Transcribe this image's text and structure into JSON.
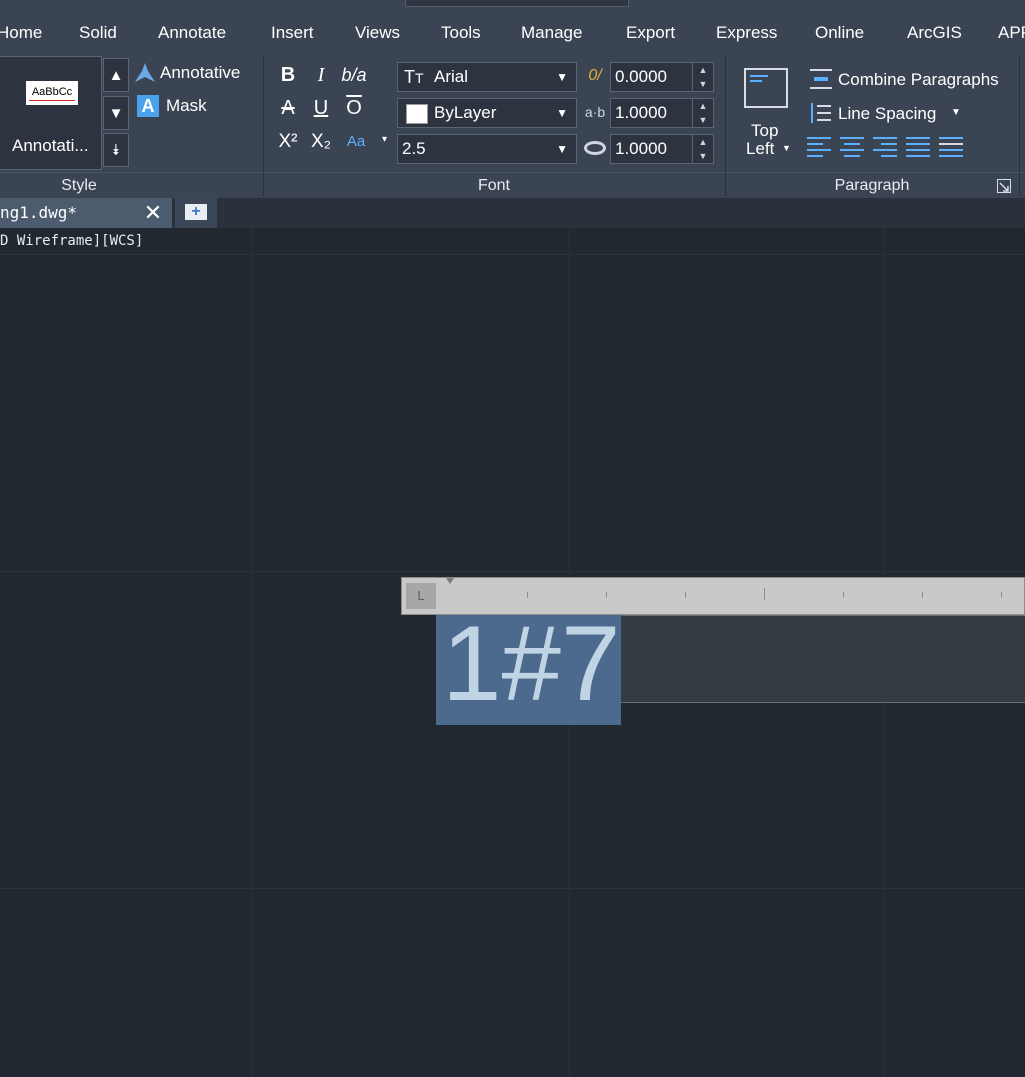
{
  "menu": {
    "items": [
      "Home",
      "Solid",
      "Annotate",
      "Insert",
      "Views",
      "Tools",
      "Manage",
      "Export",
      "Express",
      "Online",
      "ArcGIS",
      "APP"
    ]
  },
  "style_panel": {
    "title": "Style",
    "swatch_text": "AaBbCc",
    "style_name": "Annotati...",
    "annotative_label": "Annotative",
    "mask_label": "Mask",
    "scroll_up": "▲",
    "scroll_down": "▼",
    "scroll_expand": "⯯"
  },
  "font_panel": {
    "title": "Font",
    "font_name": "Arial",
    "color_name": "ByLayer",
    "text_height": "2.5",
    "oblique_angle": "0.0000",
    "tracking": "1.0000",
    "width_factor": "1.0000",
    "bold": "B",
    "italic": "I",
    "stack": "b/a",
    "strike": "A",
    "underline": "U",
    "overline": "O",
    "superscript": "X²",
    "subscript": "X₂",
    "change_case": "Aa",
    "oblique_icon_text": "0/",
    "tracking_icon_text": "a·b"
  },
  "paragraph_panel": {
    "title": "Paragraph",
    "justification_line1": "Top",
    "justification_line2": "Left",
    "combine_label": "Combine Paragraphs",
    "line_spacing_label": "Line Spacing"
  },
  "tab": {
    "label": "ng1.dwg*"
  },
  "viewport": {
    "label": "D Wireframe][WCS]"
  },
  "editor": {
    "text": "1#7",
    "tab_marker": "L"
  },
  "colors": {
    "background": "#212830",
    "ribbon": "#3b4453",
    "accent": "#5ab0ff",
    "selection": "#4b6a8e"
  }
}
